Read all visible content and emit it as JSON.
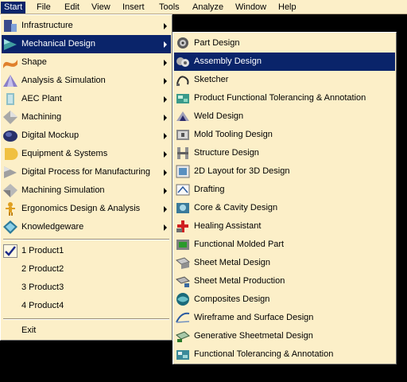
{
  "menubar": {
    "items": [
      "Start",
      "File",
      "Edit",
      "View",
      "Insert",
      "Tools",
      "Analyze",
      "Window",
      "Help"
    ],
    "active": "Start"
  },
  "start_menu": {
    "workbenches": [
      {
        "label": "Infrastructure",
        "icon": "infrastructure-icon"
      },
      {
        "label": "Mechanical Design",
        "icon": "mechanical-design-icon",
        "selected": true
      },
      {
        "label": "Shape",
        "icon": "shape-icon"
      },
      {
        "label": "Analysis & Simulation",
        "icon": "analysis-icon"
      },
      {
        "label": "AEC Plant",
        "icon": "aec-plant-icon"
      },
      {
        "label": "Machining",
        "icon": "machining-icon"
      },
      {
        "label": "Digital Mockup",
        "icon": "digital-mockup-icon"
      },
      {
        "label": "Equipment & Systems",
        "icon": "equipment-icon"
      },
      {
        "label": "Digital Process for Manufacturing",
        "icon": "digital-process-icon"
      },
      {
        "label": "Machining Simulation",
        "icon": "machining-simulation-icon"
      },
      {
        "label": "Ergonomics Design & Analysis",
        "icon": "ergonomics-icon"
      },
      {
        "label": "Knowledgeware",
        "icon": "knowledgeware-icon"
      }
    ],
    "recent": [
      {
        "label": "1 Product1",
        "checked": true
      },
      {
        "label": "2 Product2"
      },
      {
        "label": "3 Product3"
      },
      {
        "label": "4 Product4"
      }
    ],
    "exit_label": "Exit"
  },
  "mechanical_submenu": {
    "items": [
      {
        "label": "Part Design",
        "icon": "part-design-icon"
      },
      {
        "label": "Assembly Design",
        "icon": "assembly-design-icon",
        "selected": true
      },
      {
        "label": "Sketcher",
        "icon": "sketcher-icon"
      },
      {
        "label": "Product Functional Tolerancing & Annotation",
        "icon": "tolerancing-icon"
      },
      {
        "label": "Weld Design",
        "icon": "weld-design-icon"
      },
      {
        "label": "Mold Tooling Design",
        "icon": "mold-tooling-icon"
      },
      {
        "label": "Structure Design",
        "icon": "structure-design-icon"
      },
      {
        "label": "2D Layout for 3D Design",
        "icon": "layout-2d-icon"
      },
      {
        "label": "Drafting",
        "icon": "drafting-icon"
      },
      {
        "label": "Core & Cavity Design",
        "icon": "core-cavity-icon"
      },
      {
        "label": "Healing Assistant",
        "icon": "healing-assistant-icon"
      },
      {
        "label": "Functional Molded Part",
        "icon": "molded-part-icon"
      },
      {
        "label": "Sheet Metal Design",
        "icon": "sheet-metal-design-icon"
      },
      {
        "label": "Sheet Metal Production",
        "icon": "sheet-metal-production-icon"
      },
      {
        "label": "Composites Design",
        "icon": "composites-icon"
      },
      {
        "label": "Wireframe and Surface Design",
        "icon": "wireframe-surface-icon"
      },
      {
        "label": "Generative Sheetmetal Design",
        "icon": "generative-sheetmetal-icon"
      },
      {
        "label": "Functional Tolerancing & Annotation",
        "icon": "functional-tolerancing-icon"
      }
    ]
  },
  "colors": {
    "menu_bg": "#fcefc8",
    "selection": "#0a246a",
    "background": "#000000"
  }
}
